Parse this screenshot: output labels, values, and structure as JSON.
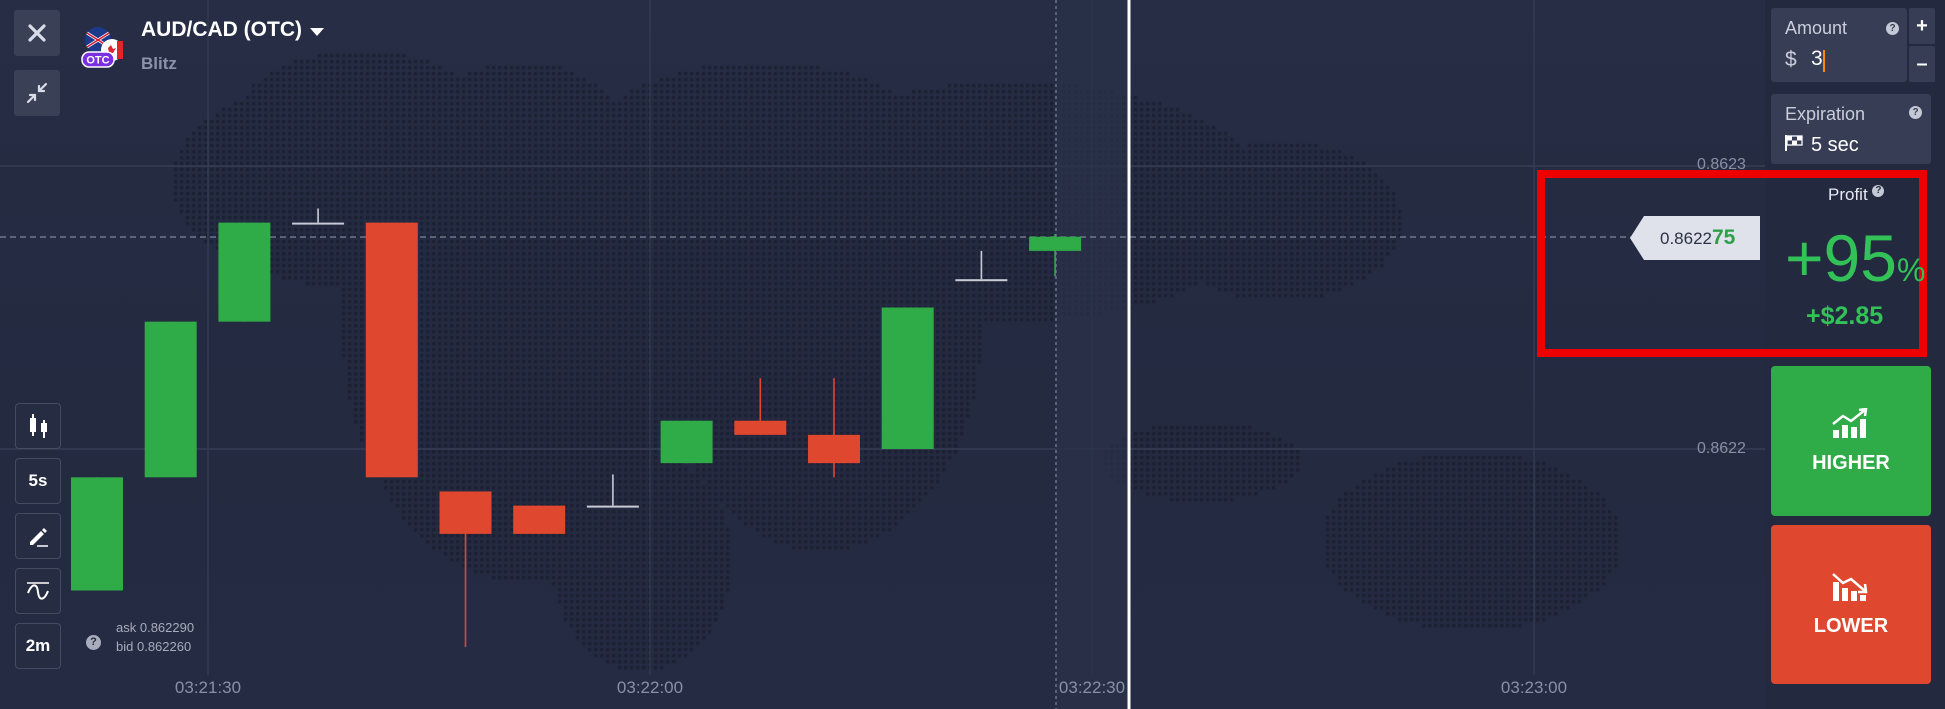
{
  "asset": {
    "title": "AUD/CAD (OTC)",
    "mode": "Blitz",
    "badge": "OTC"
  },
  "quotes": {
    "ask_label": "ask",
    "ask_value": "0.862290",
    "bid_label": "bid",
    "bid_value": "0.862260"
  },
  "tools": {
    "interval": "5s",
    "timeframe": "2m"
  },
  "chart_data": {
    "type": "candlestick",
    "x_ticks": [
      "03:21:30",
      "03:22:00",
      "03:22:30",
      "03:23:00"
    ],
    "y_ticks": [
      "0.8623",
      "0.8622"
    ],
    "current_price": {
      "prefix": "0.8622",
      "highlight": "75"
    },
    "candles": [
      {
        "open": 0.86215,
        "close": 0.86219,
        "high": 0.86219,
        "low": 0.86215
      },
      {
        "open": 0.86219,
        "close": 0.862245,
        "high": 0.862245,
        "low": 0.86219
      },
      {
        "open": 0.862245,
        "close": 0.86228,
        "high": 0.86228,
        "low": 0.862245
      },
      {
        "open": 0.86228,
        "close": 0.86228,
        "high": 0.862285,
        "low": 0.86228
      },
      {
        "open": 0.86228,
        "close": 0.86219,
        "high": 0.86228,
        "low": 0.86219
      },
      {
        "open": 0.862185,
        "close": 0.86217,
        "high": 0.862185,
        "low": 0.86213
      },
      {
        "open": 0.86218,
        "close": 0.86217,
        "high": 0.86218,
        "low": 0.86217
      },
      {
        "open": 0.86218,
        "close": 0.86218,
        "high": 0.862191,
        "low": 0.86218
      },
      {
        "open": 0.862195,
        "close": 0.86221,
        "high": 0.86221,
        "low": 0.862195
      },
      {
        "open": 0.86221,
        "close": 0.862205,
        "high": 0.862225,
        "low": 0.862205
      },
      {
        "open": 0.862205,
        "close": 0.862195,
        "high": 0.862225,
        "low": 0.86219
      },
      {
        "open": 0.8622,
        "close": 0.86225,
        "high": 0.86225,
        "low": 0.8622
      },
      {
        "open": 0.86226,
        "close": 0.86226,
        "high": 0.86227,
        "low": 0.86226
      },
      {
        "open": 0.86227,
        "close": 0.862275,
        "high": 0.862276,
        "low": 0.862261
      }
    ],
    "colors": {
      "up": "#2fab47",
      "down": "#e0472f",
      "doji": "#c9ccd6"
    }
  },
  "panel": {
    "amount_label": "Amount",
    "amount_currency": "$",
    "amount_value": "3",
    "plus": "+",
    "minus": "–",
    "expiration_label": "Expiration",
    "expiration_value": "5 sec",
    "profit_label": "Profit",
    "profit_percent_value": "+95",
    "profit_percent_sign": "%",
    "profit_amount": "+$2.85",
    "higher_label": "HIGHER",
    "lower_label": "LOWER",
    "help": "?"
  },
  "colors": {
    "background": "#232a40",
    "panel": "#363d54",
    "green": "#33c257",
    "red": "#e0472f",
    "highlight_frame": "#ee0000"
  }
}
